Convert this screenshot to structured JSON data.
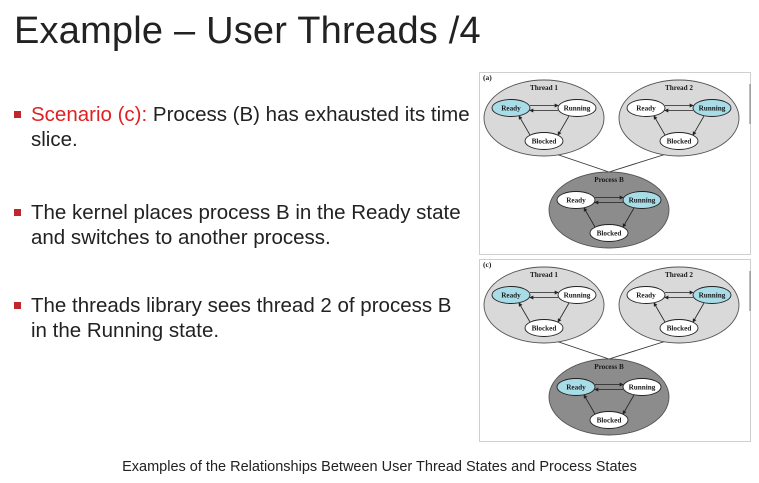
{
  "slide": {
    "title": "Example – User Threads  /4",
    "bullets": [
      {
        "highlight": "Scenario (c):",
        "text": " Process (B) has exhausted its time slice."
      },
      {
        "highlight": "",
        "text": "The kernel places process B in the Ready state and switches to another process."
      },
      {
        "highlight": "",
        "text": "The threads library sees thread 2 of process B in the Running state."
      }
    ],
    "caption": "Examples of the Relationships Between User Thread States and Process States"
  },
  "figure": {
    "panels": [
      {
        "label": "(a)",
        "thread1": {
          "title": "Thread 1",
          "ready": "Ready",
          "running": "Running",
          "blocked": "Blocked",
          "active": "ready"
        },
        "thread2": {
          "title": "Thread 2",
          "ready": "Ready",
          "running": "Running",
          "blocked": "Blocked",
          "active": "running"
        },
        "process": {
          "title": "Process B",
          "ready": "Ready",
          "running": "Running",
          "blocked": "Blocked",
          "active": "running"
        }
      },
      {
        "label": "(c)",
        "thread1": {
          "title": "Thread 1",
          "ready": "Ready",
          "running": "Running",
          "blocked": "Blocked",
          "active": "ready"
        },
        "thread2": {
          "title": "Thread 2",
          "ready": "Ready",
          "running": "Running",
          "blocked": "Blocked",
          "active": "running"
        },
        "process": {
          "title": "Process B",
          "ready": "Ready",
          "running": "Running",
          "blocked": "Blocked",
          "active": "ready"
        }
      }
    ],
    "colors": {
      "highlight_state": "#a8dde8",
      "normal_state": "#ffffff",
      "thread_bubble": "#d9d9d9",
      "process_bubble": "#8c8c8c",
      "bullet_square": "#c0272d",
      "scenario_text": "#e02020"
    }
  }
}
